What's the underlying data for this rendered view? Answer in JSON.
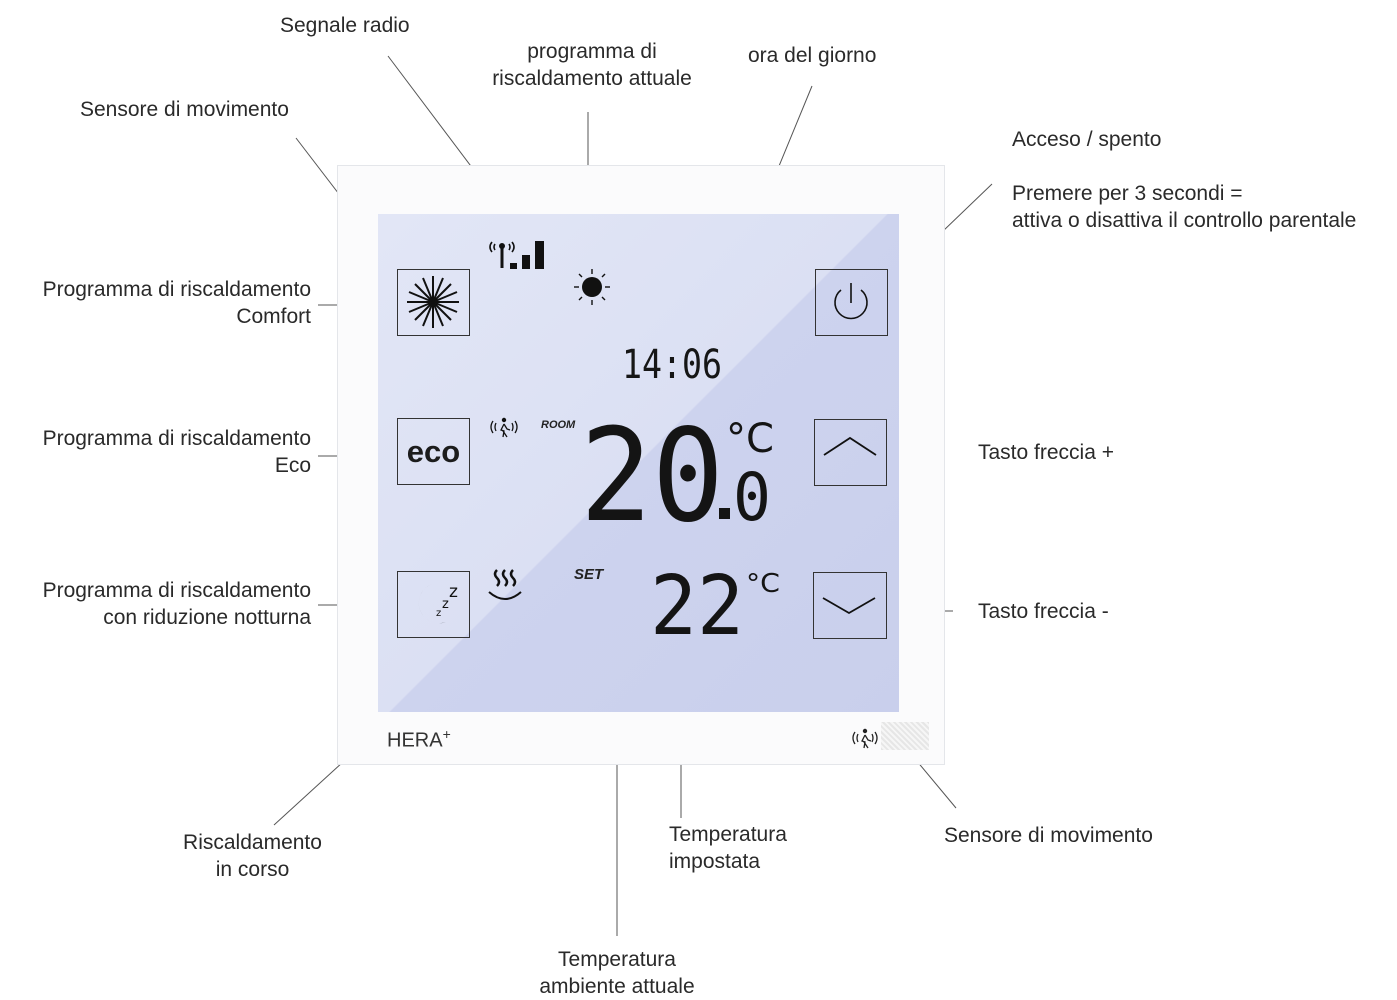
{
  "labels": {
    "signal": "Segnale radio",
    "program_current": [
      "programma di",
      "riscaldamento attuale"
    ],
    "time_of_day": "ora del giorno",
    "motion_top": "Sensore di movimento",
    "onoff": "Acceso / spento",
    "press3": [
      "Premere per 3 secondi =",
      "attiva o disattiva il controllo parentale"
    ],
    "comfort": [
      "Programma di riscaldamento",
      "Comfort"
    ],
    "eco": [
      "Programma di riscaldamento",
      "Eco"
    ],
    "night": [
      "Programma di riscaldamento",
      "con riduzione notturna"
    ],
    "arrow_plus": "Tasto freccia +",
    "arrow_minus": "Tasto freccia -",
    "heating_active": [
      "Riscaldamento",
      "in corso"
    ],
    "set_temp": [
      "Temperatura",
      "impostata"
    ],
    "motion_bottom": "Sensore di movimento",
    "room_temp": [
      "Temperatura",
      "ambiente attuale"
    ]
  },
  "display": {
    "clock": "14:06",
    "room_word": "ROOM",
    "set_word": "SET",
    "room_temp_int": "20",
    "room_temp_dec": "0",
    "set_temp": "22",
    "unit": "°C",
    "eco_key": "eco",
    "brand": "HERA",
    "brand_sup": "+"
  },
  "icons": [
    "radio-signal-icon",
    "sun-icon",
    "motion-sensor-icon",
    "comfort-sun-icon",
    "eco-icon",
    "moon-sleep-icon",
    "heating-waves-icon",
    "power-icon",
    "arrow-up-icon",
    "arrow-down-icon"
  ]
}
